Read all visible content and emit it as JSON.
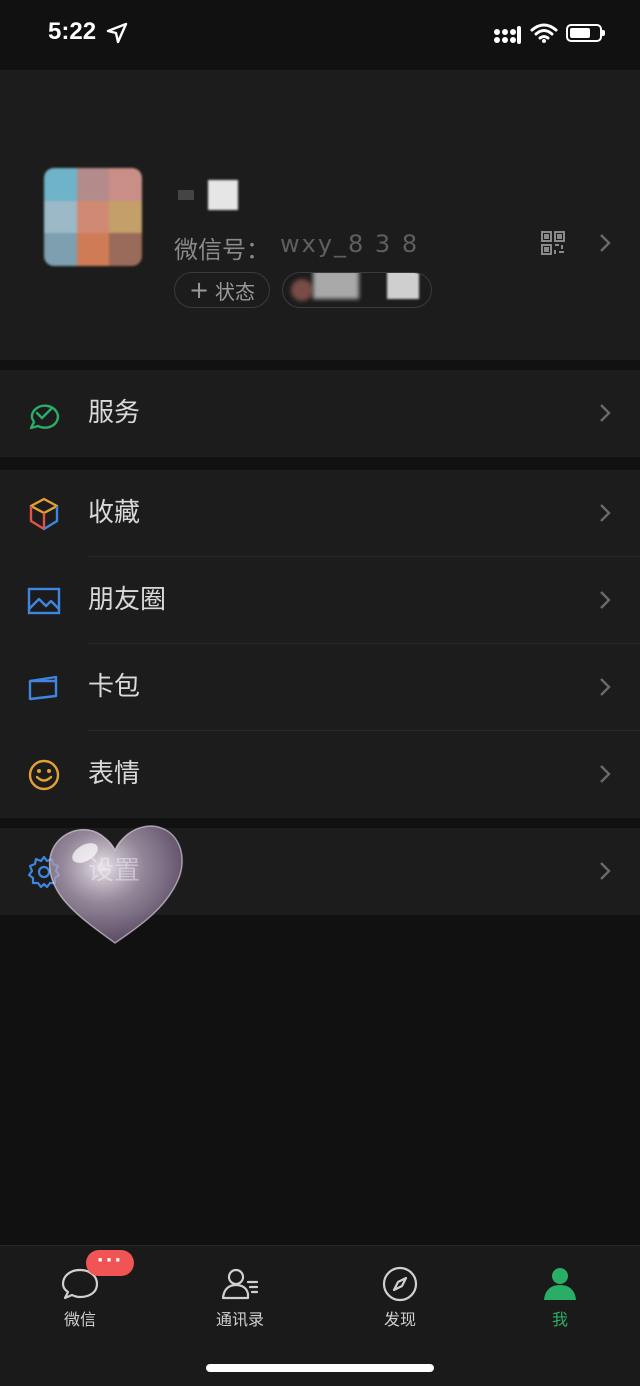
{
  "status_bar": {
    "time": "5:22"
  },
  "profile": {
    "wechat_id_label": "微信号：",
    "wechat_id_value": "wxy_8 3 8",
    "status_button": "状态",
    "status_plus": "+"
  },
  "menu": {
    "services": "服务",
    "favorites": "收藏",
    "moments": "朋友圈",
    "cards": "卡包",
    "stickers": "表情",
    "settings": "设置"
  },
  "tabbar": {
    "chats": "微信",
    "contacts": "通讯录",
    "discover": "发现",
    "me": "我",
    "chats_badge": "···"
  },
  "colors": {
    "accent_green": "#2aae67",
    "badge_red": "#f05454",
    "background": "#111111",
    "panel": "#1c1c1c"
  }
}
